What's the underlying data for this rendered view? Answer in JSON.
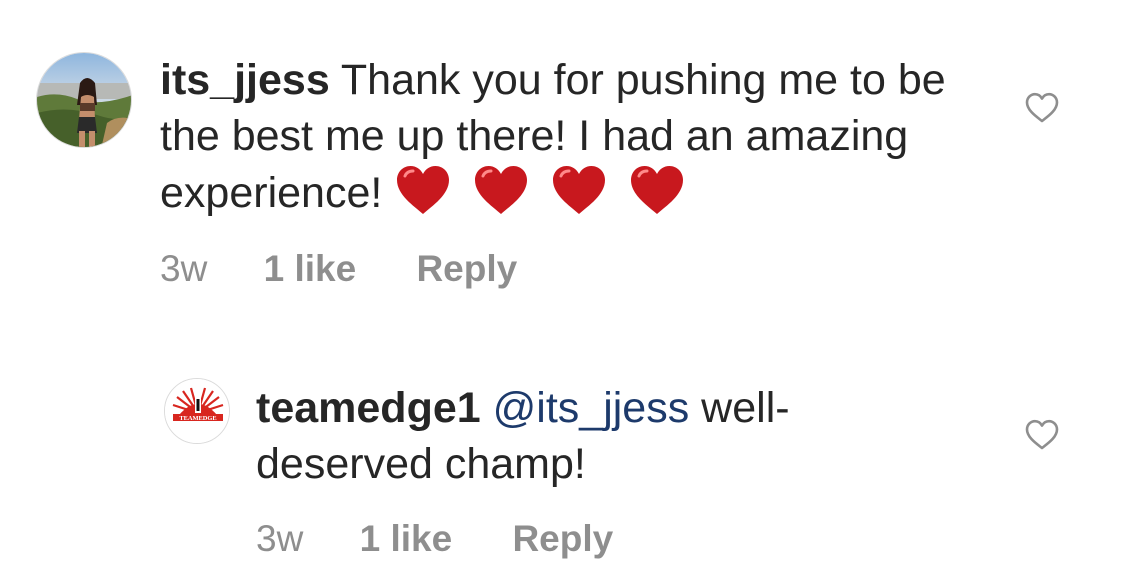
{
  "comments": [
    {
      "username": "its_jjess",
      "text": "Thank you for pushing me to be the best me up there! I had an amazing experience!",
      "emoji": [
        "red-heart",
        "red-heart",
        "red-heart",
        "red-heart"
      ],
      "time": "3w",
      "likes": "1 like",
      "reply": "Reply"
    },
    {
      "username": "teamedge1",
      "mention": "@its_jjess",
      "text": "well-deserved champ!",
      "time": "3w",
      "likes": "1 like",
      "reply": "Reply",
      "avatar_label": "TEAMEDGE"
    }
  ],
  "colors": {
    "text": "#262626",
    "meta": "#8e8e8e",
    "mention": "#1d3a6b",
    "heart_emoji": "#c8181e"
  }
}
